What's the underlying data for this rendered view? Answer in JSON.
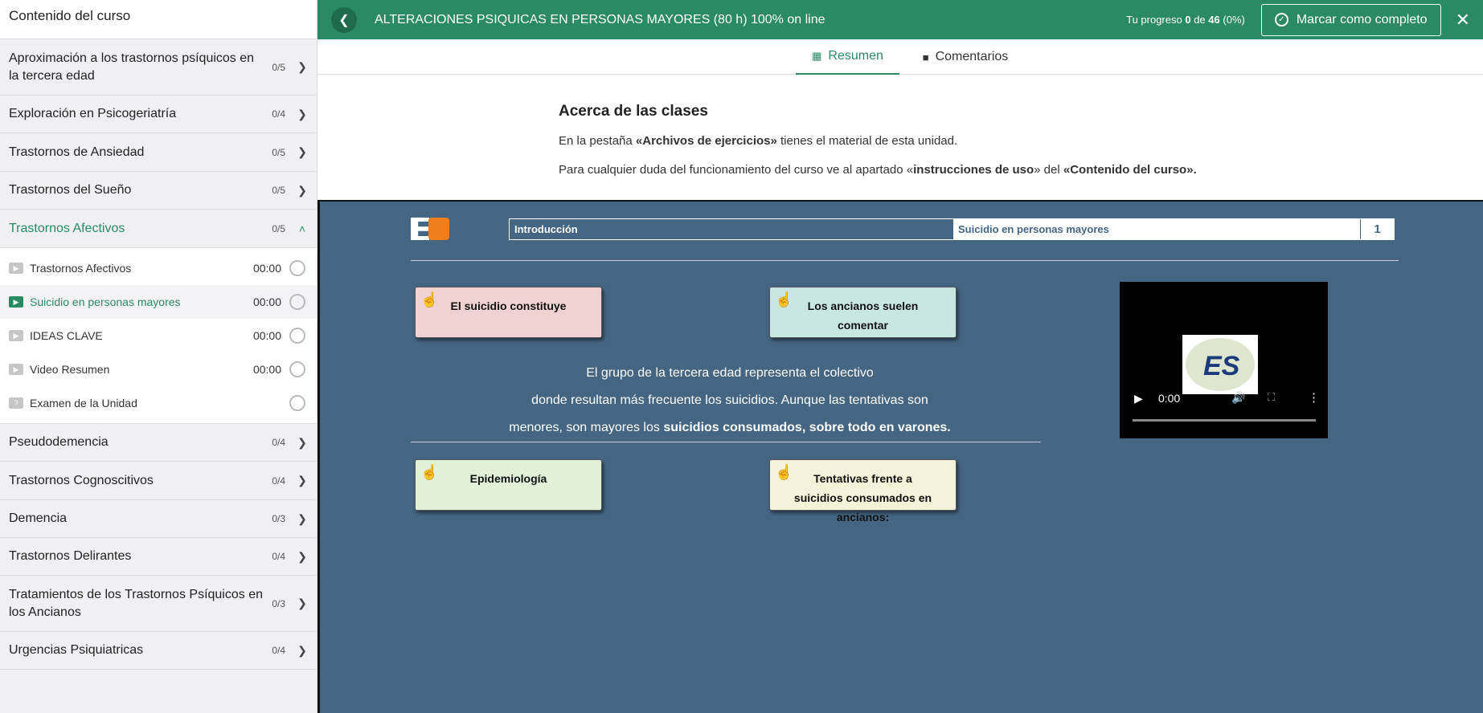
{
  "sidebar": {
    "header": "Contenido del curso",
    "sections_top": [
      {
        "title": "Aproximación a los trastornos psíquicos en la tercera edad",
        "count": "0/5"
      },
      {
        "title": "Exploración en Psicogeriatría",
        "count": "0/4"
      },
      {
        "title": "Trastornos de Ansiedad",
        "count": "0/5"
      },
      {
        "title": "Trastornos del Sueño",
        "count": "0/5"
      }
    ],
    "active_section": {
      "title": "Trastornos Afectivos",
      "count": "0/5"
    },
    "lessons": [
      {
        "title": "Trastornos Afectivos",
        "time": "00:00",
        "icon": "video-icon"
      },
      {
        "title": "Suicidio en personas mayores",
        "time": "00:00",
        "icon": "video-icon"
      },
      {
        "title": "IDEAS CLAVE",
        "time": "00:00",
        "icon": "video-icon"
      },
      {
        "title": "Video Resumen",
        "time": "00:00",
        "icon": "video-icon"
      },
      {
        "title": "Examen de la Unidad",
        "time": "",
        "icon": "quiz-icon"
      }
    ],
    "sections_bottom": [
      {
        "title": "Pseudodemencia",
        "count": "0/4"
      },
      {
        "title": "Trastornos Cognoscitivos",
        "count": "0/4"
      },
      {
        "title": "Demencia",
        "count": "0/3"
      },
      {
        "title": "Trastornos Delirantes",
        "count": "0/4"
      },
      {
        "title": "Tratamientos de los Trastornos Psíquicos en los Ancianos",
        "count": "0/3"
      },
      {
        "title": "Urgencias Psiquiatricas",
        "count": "0/4"
      }
    ]
  },
  "topbar": {
    "course_title": "ALTERACIONES PSIQUICAS EN PERSONAS MAYORES (80 h) 100% on line",
    "progress_prefix": "Tu progreso",
    "progress_done": "0",
    "progress_of": "de",
    "progress_total": "46",
    "progress_pct": "(0%)",
    "complete_label": "Marcar como completo"
  },
  "tabs": {
    "summary": "Resumen",
    "comments": "Comentarios"
  },
  "about": {
    "title": "Acerca de las clases",
    "p1_a": "En la pestaña ",
    "p1_b": "«Archivos de ejercicios»",
    "p1_c": " tienes el material de esta unidad.",
    "p2_a": "Para cualquier duda del funcionamiento del curso ve al apartado «",
    "p2_b": "instrucciones de uso",
    "p2_c": "» del ",
    "p2_d": "«Contenido del curso»."
  },
  "player": {
    "nav_intro": "Introducción",
    "nav_current": "Suicidio en personas mayores",
    "nav_page": "1",
    "cards": {
      "c1": "El suicidio constituye",
      "c2": "Los ancianos suelen comentar",
      "c3": "Epidemiología",
      "c4": "Tentativas frente a suicidios consumados en ancianos:"
    },
    "text_l1": "El grupo de la tercera edad representa el colectivo",
    "text_l2": "donde resultan más frecuente los suicidios. Aunque las tentativas son",
    "text_l3_a": "menores, son mayores los ",
    "text_l3_b": "suicidios consumados, sobre todo en varones.",
    "video": {
      "time": "0:00",
      "logo_text": "ES"
    }
  },
  "colors": {
    "accent": "#2a8a63",
    "player_bg": "#456683"
  }
}
